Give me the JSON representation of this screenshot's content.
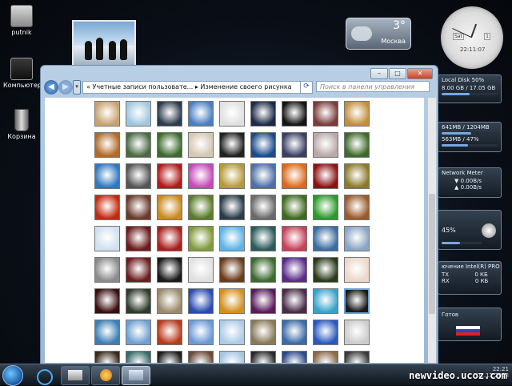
{
  "desktop": {
    "icons": [
      {
        "label": "putnik"
      },
      {
        "label": "Компьютер"
      },
      {
        "label": "Корзина"
      }
    ]
  },
  "weather": {
    "temp": "3°",
    "city": "Москва"
  },
  "clock": {
    "day": "Sat",
    "date": "1",
    "time": "22:11:07"
  },
  "gadgets": {
    "disk": {
      "title": "Local Disk  50%",
      "usage": "8.00 GB / 17.05 GB",
      "percent": 50
    },
    "memory": {
      "line1": "641MB / 1204MB",
      "line2": "563MB / 47%",
      "percent": 47
    },
    "network": {
      "title": "Network Meter",
      "down": "0.00B/s",
      "up": "0.00B/s"
    },
    "volume": {
      "value": "45%",
      "percent": 45
    },
    "adapter": {
      "title": "ючение Intel(R) PRO",
      "tx_label": "TX",
      "tx_value": "0 КБ",
      "rx_label": "RX",
      "rx_value": "0 КБ"
    },
    "lang": {
      "title": "Готов"
    }
  },
  "window": {
    "breadcrumb": "«  Учетные записи пользовате...  ▸  Изменение своего рисунка",
    "search_placeholder": "Поиск в панели управления",
    "buttons": {
      "minimize": "–",
      "maximize": "□",
      "close": "✕"
    }
  },
  "pictures": {
    "colors": [
      [
        "#c9a272",
        "#9fc7de",
        "#2c3a4d",
        "#4a7fbf",
        "#e0e0e0",
        "#1b2a47",
        "#141414",
        "#7a3c3a",
        "#c28f3e"
      ],
      [
        "#b06a2a",
        "#4b6a44",
        "#3c6a2e",
        "#d6c6b4",
        "#222222",
        "#1d4a8a",
        "#3a3f62",
        "#b9a8a8",
        "#3d6a2a"
      ],
      [
        "#2f78c0",
        "#555555",
        "#b01b1b",
        "#c54ab8",
        "#b59a3a",
        "#4d6fa8",
        "#dc6a1b",
        "#8a1212",
        "#8a7a2a"
      ],
      [
        "#c22a0e",
        "#6a3a2a",
        "#c8891e",
        "#5b7b2a",
        "#2a3a4a",
        "#6a6a6a",
        "#3f6a1e",
        "#2a9a2a",
        "#9a5a2a"
      ],
      [
        "#cfe0ee",
        "#6a1b1b",
        "#a8201e",
        "#7f9a3a",
        "#5db3e6",
        "#2a5a5a",
        "#c8405a",
        "#3b6ca0",
        "#8aa4c4"
      ],
      [
        "#8a8a8a",
        "#6a1d1d",
        "#1a1a1a",
        "#e0e0e0",
        "#6a3b1b",
        "#3a6a2e",
        "#5a2a8a",
        "#2a3a1a",
        "#ecd7c8"
      ],
      [
        "#3a0f0f",
        "#2e3a2a",
        "#9a8a6a",
        "#2a4ab0",
        "#d2901e",
        "#5a1b5a",
        "#4a2a4a",
        "#37a2c8",
        "#1b1b1b"
      ],
      [
        "#3c7eb6",
        "#6ea0d0",
        "#b83a1a",
        "#6a9ad6",
        "#aacbe6",
        "#8a7a5a",
        "#3a6aa8",
        "#2a58c0",
        "#cccccc"
      ],
      [
        "#3a2a1a",
        "#3a6a6a",
        "#1e1e1e",
        "#6a4a3a",
        "#a6c4e0",
        "#2a2a2a",
        "#2a4a8a",
        "#8a6a4a",
        "#3a3a3a"
      ]
    ]
  },
  "taskbar": {
    "time": "22:21",
    "date": "01.11.2008"
  },
  "watermark": "newvideo.ucoz.com"
}
